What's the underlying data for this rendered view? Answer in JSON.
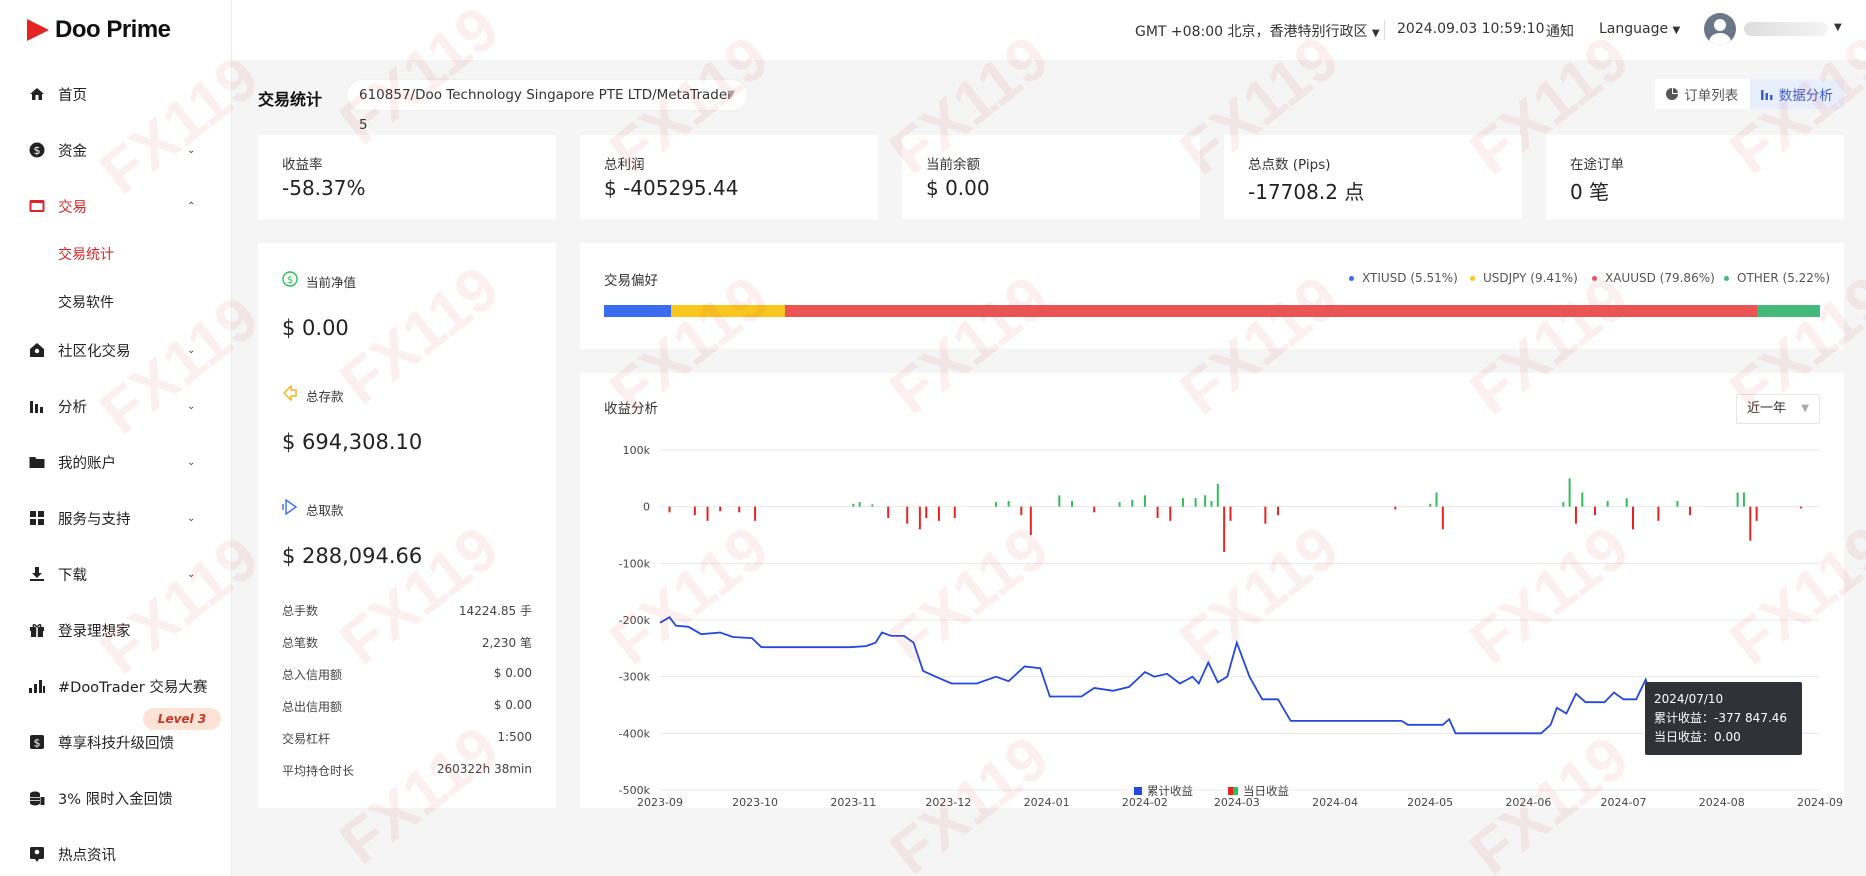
{
  "brand": {
    "name": "Doo Prime"
  },
  "header": {
    "timezone": "GMT +08:00 北京，香港特别行政区",
    "datetime": "2024.09.03 10:59:10",
    "notifications": "通知",
    "language": "Language"
  },
  "sidebar": {
    "items": [
      {
        "label": "首页",
        "icon": "home-icon"
      },
      {
        "label": "资金",
        "icon": "dollar-icon"
      },
      {
        "label": "交易",
        "icon": "card-icon"
      },
      {
        "label": "社区化交易",
        "icon": "house-icon"
      },
      {
        "label": "分析",
        "icon": "bars-icon"
      },
      {
        "label": "我的账户",
        "icon": "folder-icon"
      },
      {
        "label": "服务与支持",
        "icon": "grid-icon"
      },
      {
        "label": "下载",
        "icon": "download-icon"
      },
      {
        "label": "登录理想家",
        "icon": "gift-icon"
      },
      {
        "label": "#DooTrader 交易大赛",
        "icon": "chart-icon"
      },
      {
        "label": "尊享科技升级回馈",
        "icon": "dollar-box-icon"
      },
      {
        "label": "3% 限时入金回馈",
        "icon": "coins-icon"
      },
      {
        "label": "热点资讯",
        "icon": "pin-icon"
      }
    ],
    "sub_items": [
      "交易统计",
      "交易软件"
    ],
    "level_badge": "Level 3"
  },
  "page": {
    "title": "交易统计",
    "account": "610857/Doo Technology Singapore PTE LTD/MetaTrader 5",
    "view_toggle": [
      "订单列表",
      "数据分析"
    ]
  },
  "stats": [
    {
      "label": "收益率",
      "value": "-58.37%"
    },
    {
      "label": "总利润",
      "value": "$ -405295.44"
    },
    {
      "label": "当前余额",
      "value": "$ 0.00"
    },
    {
      "label": "总点数 (Pips)",
      "value": "-17708.2 点"
    },
    {
      "label": "在途订单",
      "value": "0 笔"
    }
  ],
  "summary": {
    "equity_label": "当前净值",
    "equity": "$ 0.00",
    "deposit_label": "总存款",
    "deposit": "$ 694,308.10",
    "withdraw_label": "总取款",
    "withdraw": "$ 288,094.66",
    "details": [
      {
        "k": "总手数",
        "v": "14224.85 手"
      },
      {
        "k": "总笔数",
        "v": "2,230 笔"
      },
      {
        "k": "总入信用额",
        "v": "$ 0.00"
      },
      {
        "k": "总出信用额",
        "v": "$ 0.00"
      },
      {
        "k": "交易杠杆",
        "v": "1:500"
      },
      {
        "k": "平均持仓时长",
        "v": "260322h 38min"
      }
    ]
  },
  "preference": {
    "title": "交易偏好",
    "segments": [
      {
        "name": "XTIUSD (5.51%)",
        "pct": 5.51,
        "color": "#3b6cf0"
      },
      {
        "name": "USDJPY (9.41%)",
        "pct": 9.41,
        "color": "#f8c61c"
      },
      {
        "name": "XAUUSD (79.86%)",
        "pct": 79.86,
        "color": "#ea5455"
      },
      {
        "name": "OTHER (5.22%)",
        "pct": 5.22,
        "color": "#45b97c"
      }
    ]
  },
  "profit": {
    "title": "收益分析",
    "range": "近一年",
    "legend": [
      "累计收益",
      "当日收益"
    ],
    "tooltip": {
      "date": "2024/07/10",
      "cum": "累计收益：-377 847.46",
      "daily": "当日收益：0.00"
    }
  },
  "chart_data": {
    "type": "line",
    "title": "收益分析",
    "ylim": [
      -500000,
      100000
    ],
    "y_ticks": [
      "100k",
      "0",
      "-100k",
      "-200k",
      "-300k",
      "-400k",
      "-500k"
    ],
    "x_ticks": [
      "2023-09",
      "2023-10",
      "2023-11",
      "2023-12",
      "2024-01",
      "2024-02",
      "2024-03",
      "2024-04",
      "2024-05",
      "2024-06",
      "2024-07",
      "2024-08",
      "2024-09"
    ],
    "series": [
      {
        "name": "累计收益",
        "color": "#2648d8",
        "points": [
          [
            "2023-09-01",
            -205000
          ],
          [
            "2023-09-04",
            -195000
          ],
          [
            "2023-09-06",
            -210000
          ],
          [
            "2023-09-10",
            -212000
          ],
          [
            "2023-09-14",
            -225000
          ],
          [
            "2023-09-20",
            -222000
          ],
          [
            "2023-09-24",
            -230000
          ],
          [
            "2023-09-30",
            -232000
          ],
          [
            "2023-10-03",
            -248000
          ],
          [
            "2023-10-15",
            -248000
          ],
          [
            "2023-10-31",
            -248000
          ],
          [
            "2023-11-05",
            -246000
          ],
          [
            "2023-11-08",
            -240000
          ],
          [
            "2023-11-10",
            -222000
          ],
          [
            "2023-11-13",
            -228000
          ],
          [
            "2023-11-17",
            -228000
          ],
          [
            "2023-11-20",
            -240000
          ],
          [
            "2023-11-23",
            -290000
          ],
          [
            "2023-11-27",
            -300000
          ],
          [
            "2023-12-02",
            -312000
          ],
          [
            "2023-12-10",
            -312000
          ],
          [
            "2023-12-16",
            -300000
          ],
          [
            "2023-12-20",
            -308000
          ],
          [
            "2023-12-25",
            -282000
          ],
          [
            "2023-12-30",
            -285000
          ],
          [
            "2024-01-02",
            -335000
          ],
          [
            "2024-01-12",
            -335000
          ],
          [
            "2024-01-16",
            -320000
          ],
          [
            "2024-01-22",
            -325000
          ],
          [
            "2024-01-27",
            -318000
          ],
          [
            "2024-02-01",
            -292000
          ],
          [
            "2024-02-04",
            -300000
          ],
          [
            "2024-02-08",
            -295000
          ],
          [
            "2024-02-12",
            -312000
          ],
          [
            "2024-02-16",
            -300000
          ],
          [
            "2024-02-18",
            -312000
          ],
          [
            "2024-02-21",
            -275000
          ],
          [
            "2024-02-24",
            -310000
          ],
          [
            "2024-02-27",
            -300000
          ],
          [
            "2024-03-01",
            -240000
          ],
          [
            "2024-03-05",
            -300000
          ],
          [
            "2024-03-09",
            -340000
          ],
          [
            "2024-03-14",
            -340000
          ],
          [
            "2024-03-18",
            -378000
          ],
          [
            "2024-03-28",
            -378000
          ],
          [
            "2024-04-15",
            -378000
          ],
          [
            "2024-04-22",
            -378000
          ],
          [
            "2024-04-24",
            -385000
          ],
          [
            "2024-05-05",
            -385000
          ],
          [
            "2024-05-07",
            -375000
          ],
          [
            "2024-05-09",
            -400000
          ],
          [
            "2024-05-25",
            -400000
          ],
          [
            "2024-06-05",
            -400000
          ],
          [
            "2024-06-08",
            -385000
          ],
          [
            "2024-06-10",
            -355000
          ],
          [
            "2024-06-13",
            -365000
          ],
          [
            "2024-06-16",
            -330000
          ],
          [
            "2024-06-19",
            -345000
          ],
          [
            "2024-06-25",
            -345000
          ],
          [
            "2024-06-28",
            -328000
          ],
          [
            "2024-07-01",
            -340000
          ],
          [
            "2024-07-05",
            -340000
          ],
          [
            "2024-07-08",
            -305000
          ],
          [
            "2024-07-10",
            -340000
          ],
          [
            "2024-07-15",
            -340000
          ],
          [
            "2024-07-18",
            -350000
          ],
          [
            "2024-07-22",
            -340000
          ],
          [
            "2024-07-26",
            -362000
          ],
          [
            "2024-07-30",
            -378000
          ],
          [
            "2024-08-10",
            -378000
          ],
          [
            "2024-08-12",
            -370000
          ],
          [
            "2024-08-14",
            -322000
          ],
          [
            "2024-08-16",
            -378000
          ],
          [
            "2024-08-20",
            -378000
          ]
        ]
      },
      {
        "name": "当日收益",
        "type": "bar",
        "pos_color": "#2ebd59",
        "neg_color": "#e52421",
        "points": [
          [
            "2023-09-04",
            -10000
          ],
          [
            "2023-09-12",
            -15000
          ],
          [
            "2023-09-16",
            -25000
          ],
          [
            "2023-09-20",
            -8000
          ],
          [
            "2023-09-26",
            -10000
          ],
          [
            "2023-10-01",
            -25000
          ],
          [
            "2023-11-01",
            5000
          ],
          [
            "2023-11-03",
            8000
          ],
          [
            "2023-11-07",
            4000
          ],
          [
            "2023-11-12",
            -20000
          ],
          [
            "2023-11-18",
            -30000
          ],
          [
            "2023-11-22",
            -40000
          ],
          [
            "2023-11-24",
            -20000
          ],
          [
            "2023-11-28",
            -25000
          ],
          [
            "2023-12-03",
            -20000
          ],
          [
            "2023-12-16",
            8000
          ],
          [
            "2023-12-20",
            10000
          ],
          [
            "2023-12-24",
            -15000
          ],
          [
            "2023-12-27",
            -50000
          ],
          [
            "2024-01-05",
            20000
          ],
          [
            "2024-01-09",
            10000
          ],
          [
            "2024-01-16",
            -10000
          ],
          [
            "2024-01-24",
            8000
          ],
          [
            "2024-01-28",
            12000
          ],
          [
            "2024-02-01",
            20000
          ],
          [
            "2024-02-05",
            -20000
          ],
          [
            "2024-02-09",
            -25000
          ],
          [
            "2024-02-13",
            15000
          ],
          [
            "2024-02-17",
            15000
          ],
          [
            "2024-02-20",
            20000
          ],
          [
            "2024-02-22",
            10000
          ],
          [
            "2024-02-24",
            40000
          ],
          [
            "2024-02-26",
            -80000
          ],
          [
            "2024-02-28",
            -25000
          ],
          [
            "2024-03-10",
            -30000
          ],
          [
            "2024-03-14",
            -15000
          ],
          [
            "2024-04-20",
            -5000
          ],
          [
            "2024-05-01",
            5000
          ],
          [
            "2024-05-03",
            25000
          ],
          [
            "2024-05-05",
            -40000
          ],
          [
            "2024-06-12",
            8000
          ],
          [
            "2024-06-14",
            50000
          ],
          [
            "2024-06-16",
            -30000
          ],
          [
            "2024-06-18",
            25000
          ],
          [
            "2024-06-22",
            -15000
          ],
          [
            "2024-06-26",
            10000
          ],
          [
            "2024-07-02",
            15000
          ],
          [
            "2024-07-04",
            -40000
          ],
          [
            "2024-07-12",
            -25000
          ],
          [
            "2024-07-18",
            10000
          ],
          [
            "2024-07-22",
            -15000
          ],
          [
            "2024-08-06",
            25000
          ],
          [
            "2024-08-08",
            25000
          ],
          [
            "2024-08-10",
            -60000
          ],
          [
            "2024-08-12",
            -25000
          ],
          [
            "2024-08-26",
            -3000
          ]
        ]
      }
    ]
  }
}
